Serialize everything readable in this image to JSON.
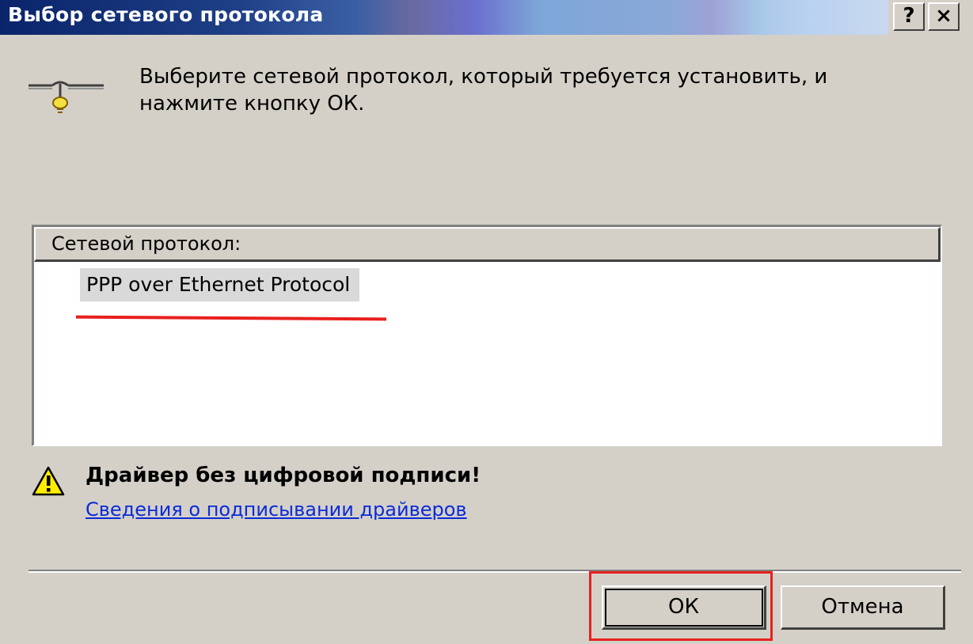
{
  "window": {
    "title": "Выбор сетевого протокола",
    "help_label": "?",
    "close_label": "×"
  },
  "header": {
    "instruction": "Выберите сетевой протокол, который требуется установить, и нажмите кнопку ОК.",
    "icon": "network-protocol-icon"
  },
  "list": {
    "column_header": "Сетевой протокол:",
    "items": [
      {
        "label": "PPP over Ethernet Protocol",
        "selected": true
      }
    ]
  },
  "warning": {
    "icon": "warning-icon",
    "title": "Драйвер без цифровой подписи!",
    "link": "Сведения о подписывании драйверов"
  },
  "buttons": {
    "ok": "ОК",
    "cancel": "Отмена"
  },
  "colors": {
    "title_bar": "#0a246a",
    "dialog_bg": "#d4d0c8",
    "link": "#0b2bd8",
    "annotation": "#e8201e"
  }
}
